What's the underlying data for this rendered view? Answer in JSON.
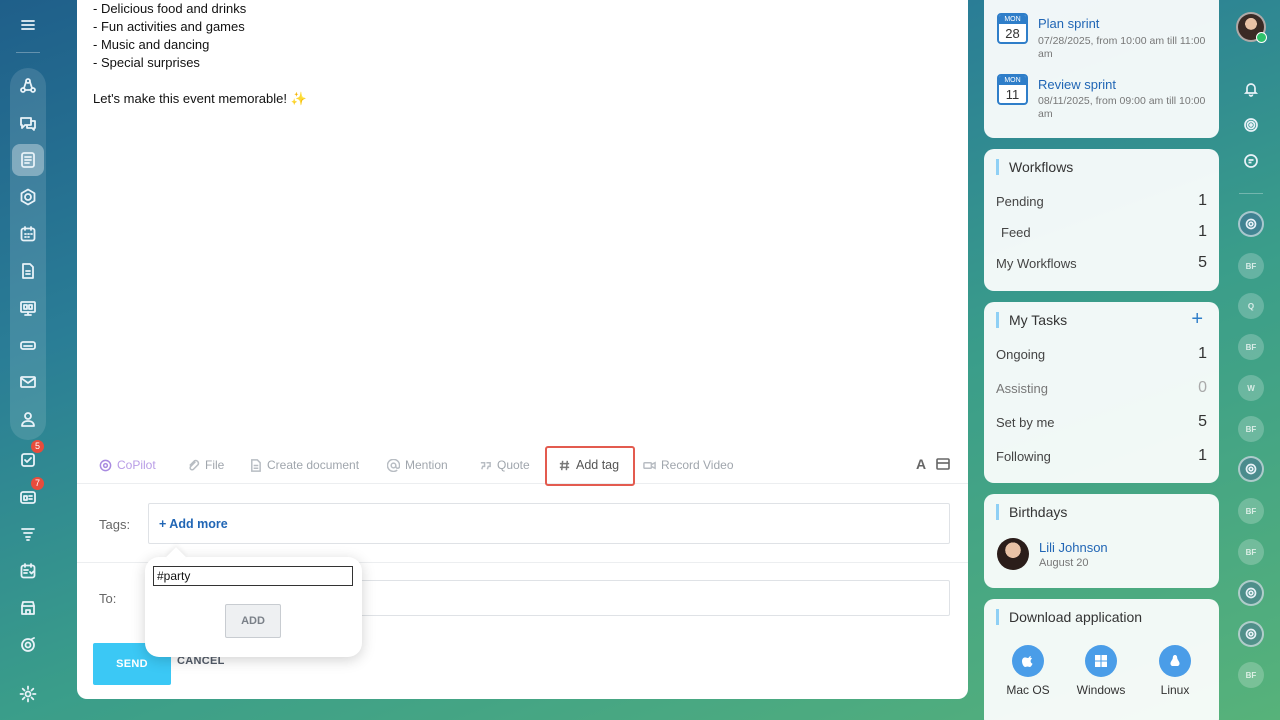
{
  "post": {
    "lines": [
      "- Delicious food and drinks",
      "- Fun activities and games",
      "- Music and dancing",
      "- Special surprises"
    ],
    "closing": "Let's make this event memorable!",
    "closing_emoji": "✨"
  },
  "toolbar": {
    "copilot": "CoPilot",
    "file": "File",
    "create_document": "Create document",
    "mention": "Mention",
    "quote": "Quote",
    "add_tag": "Add tag",
    "record_video": "Record Video",
    "text_format": "A"
  },
  "tags": {
    "label": "Tags:",
    "add_more": "+ Add more"
  },
  "tag_popup": {
    "input_value": "#party",
    "add_button": "ADD"
  },
  "recipients": {
    "label": "To:"
  },
  "actions": {
    "send": "SEND",
    "cancel": "CANCEL"
  },
  "events": [
    {
      "month": "MON",
      "day": "28",
      "title": "Plan sprint",
      "when": "07/28/2025, from 10:00 am till 11:00 am"
    },
    {
      "month": "MON",
      "day": "11",
      "title": "Review sprint",
      "when": "08/11/2025, from 09:00 am till 10:00 am"
    }
  ],
  "workflows": {
    "title": "Workflows",
    "rows": [
      {
        "label": "Pending",
        "count": "1"
      },
      {
        "label": "Feed",
        "count": "1"
      },
      {
        "label": "My Workflows",
        "count": "5"
      }
    ]
  },
  "tasks": {
    "title": "My Tasks",
    "add": "+",
    "rows": [
      {
        "label": "Ongoing",
        "count": "1"
      },
      {
        "label": "Assisting",
        "count": "0"
      },
      {
        "label": "Set by me",
        "count": "5"
      },
      {
        "label": "Following",
        "count": "1"
      }
    ]
  },
  "birthdays": {
    "title": "Birthdays",
    "name": "Lili Johnson",
    "date": "August 20"
  },
  "download": {
    "title": "Download application",
    "apps": [
      {
        "label": "Mac OS",
        "icon": "apple-icon"
      },
      {
        "label": "Windows",
        "icon": "windows-icon"
      },
      {
        "label": "Linux",
        "icon": "linux-icon"
      }
    ]
  },
  "left_rail_badges": {
    "tasks": "5",
    "feed": "7"
  },
  "right_rail_avatars": [
    "BF",
    "Q",
    "BF",
    "W",
    "BF",
    "BF",
    "BF",
    "BF"
  ],
  "colors": {
    "accent": "#3bc8f5",
    "link": "#2166b5",
    "highlight": "#e35b4f"
  }
}
